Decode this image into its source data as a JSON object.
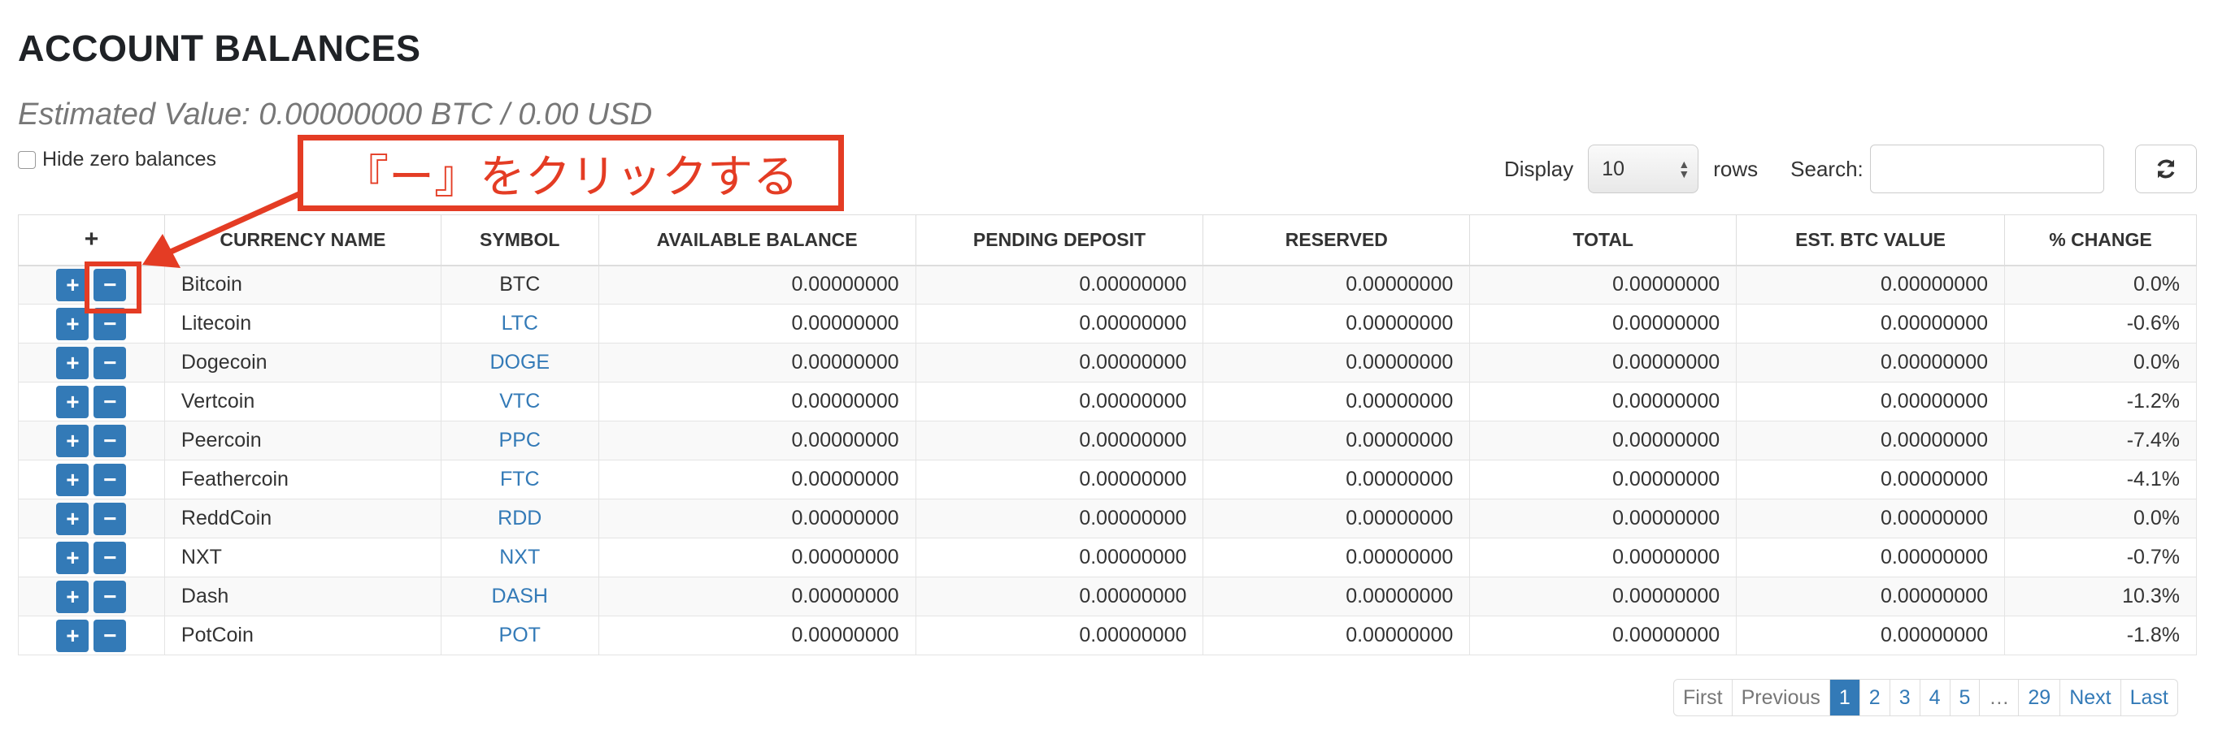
{
  "header": {
    "title": "ACCOUNT BALANCES",
    "estimated_value": "Estimated Value: 0.00000000 BTC / 0.00 USD"
  },
  "filters": {
    "hide_zero_label": "Hide zero balances",
    "display_label": "Display",
    "display_value": "10",
    "rows_label": "rows",
    "search_label": "Search:",
    "search_value": ""
  },
  "icons": {
    "refresh": "refresh-icon",
    "add": "plus-icon",
    "remove": "minus-icon"
  },
  "table": {
    "header_add": "+",
    "columns": [
      "CURRENCY NAME",
      "SYMBOL",
      "AVAILABLE BALANCE",
      "PENDING DEPOSIT",
      "RESERVED",
      "TOTAL",
      "EST. BTC VALUE",
      "% CHANGE"
    ],
    "rows": [
      {
        "name": "Bitcoin",
        "symbol": "BTC",
        "available": "0.00000000",
        "pending": "0.00000000",
        "reserved": "0.00000000",
        "total": "0.00000000",
        "btc_value": "0.00000000",
        "change": "0.0%"
      },
      {
        "name": "Litecoin",
        "symbol": "LTC",
        "available": "0.00000000",
        "pending": "0.00000000",
        "reserved": "0.00000000",
        "total": "0.00000000",
        "btc_value": "0.00000000",
        "change": "-0.6%"
      },
      {
        "name": "Dogecoin",
        "symbol": "DOGE",
        "available": "0.00000000",
        "pending": "0.00000000",
        "reserved": "0.00000000",
        "total": "0.00000000",
        "btc_value": "0.00000000",
        "change": "0.0%"
      },
      {
        "name": "Vertcoin",
        "symbol": "VTC",
        "available": "0.00000000",
        "pending": "0.00000000",
        "reserved": "0.00000000",
        "total": "0.00000000",
        "btc_value": "0.00000000",
        "change": "-1.2%"
      },
      {
        "name": "Peercoin",
        "symbol": "PPC",
        "available": "0.00000000",
        "pending": "0.00000000",
        "reserved": "0.00000000",
        "total": "0.00000000",
        "btc_value": "0.00000000",
        "change": "-7.4%"
      },
      {
        "name": "Feathercoin",
        "symbol": "FTC",
        "available": "0.00000000",
        "pending": "0.00000000",
        "reserved": "0.00000000",
        "total": "0.00000000",
        "btc_value": "0.00000000",
        "change": "-4.1%"
      },
      {
        "name": "ReddCoin",
        "symbol": "RDD",
        "available": "0.00000000",
        "pending": "0.00000000",
        "reserved": "0.00000000",
        "total": "0.00000000",
        "btc_value": "0.00000000",
        "change": "0.0%"
      },
      {
        "name": "NXT",
        "symbol": "NXT",
        "available": "0.00000000",
        "pending": "0.00000000",
        "reserved": "0.00000000",
        "total": "0.00000000",
        "btc_value": "0.00000000",
        "change": "-0.7%"
      },
      {
        "name": "Dash",
        "symbol": "DASH",
        "available": "0.00000000",
        "pending": "0.00000000",
        "reserved": "0.00000000",
        "total": "0.00000000",
        "btc_value": "0.00000000",
        "change": "10.3%"
      },
      {
        "name": "PotCoin",
        "symbol": "POT",
        "available": "0.00000000",
        "pending": "0.00000000",
        "reserved": "0.00000000",
        "total": "0.00000000",
        "btc_value": "0.00000000",
        "change": "-1.8%"
      }
    ]
  },
  "pagination": [
    "First",
    "Previous",
    "1",
    "2",
    "3",
    "4",
    "5",
    "…",
    "29",
    "Next",
    "Last"
  ],
  "pagination_active": "1",
  "annotation": {
    "text": "『ー』をクリックする",
    "color": "#e43c24"
  },
  "colors": {
    "accent": "#337ab7",
    "annotation": "#e43c24"
  }
}
